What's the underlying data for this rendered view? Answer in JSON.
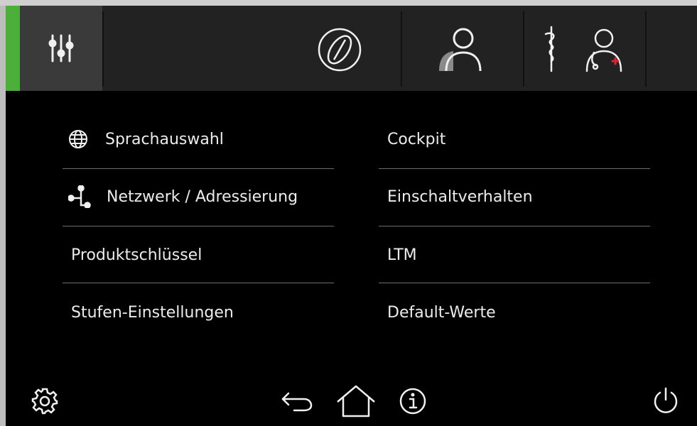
{
  "colors": {
    "accent_green": "#4caf3a",
    "header_bg": "#222222",
    "active_tab_bg": "#3a3a3a",
    "medical_cross": "#e0242f"
  },
  "header": {
    "tabs": [
      {
        "icon": "settings-sliders-icon",
        "active": true
      },
      {
        "icon": "coffee-bean-icon",
        "active": false
      },
      {
        "icon": "user-icon",
        "active": false
      },
      {
        "icon": "service-technician-icon",
        "active": false
      }
    ]
  },
  "menu": {
    "left": [
      {
        "label": "Sprachauswahl",
        "icon": "globe-icon"
      },
      {
        "label": "Netzwerk / Adressierung",
        "icon": "network-icon"
      },
      {
        "label": "Produktschlüssel"
      },
      {
        "label": "Stufen-Einstellungen"
      }
    ],
    "right": [
      {
        "label": "Cockpit"
      },
      {
        "label": "Einschaltverhalten"
      },
      {
        "label": "LTM"
      },
      {
        "label": "Default-Werte"
      }
    ]
  },
  "footer": {
    "icons": [
      "gear-icon",
      "back-arrow-icon",
      "home-icon",
      "info-icon",
      "power-icon"
    ]
  }
}
